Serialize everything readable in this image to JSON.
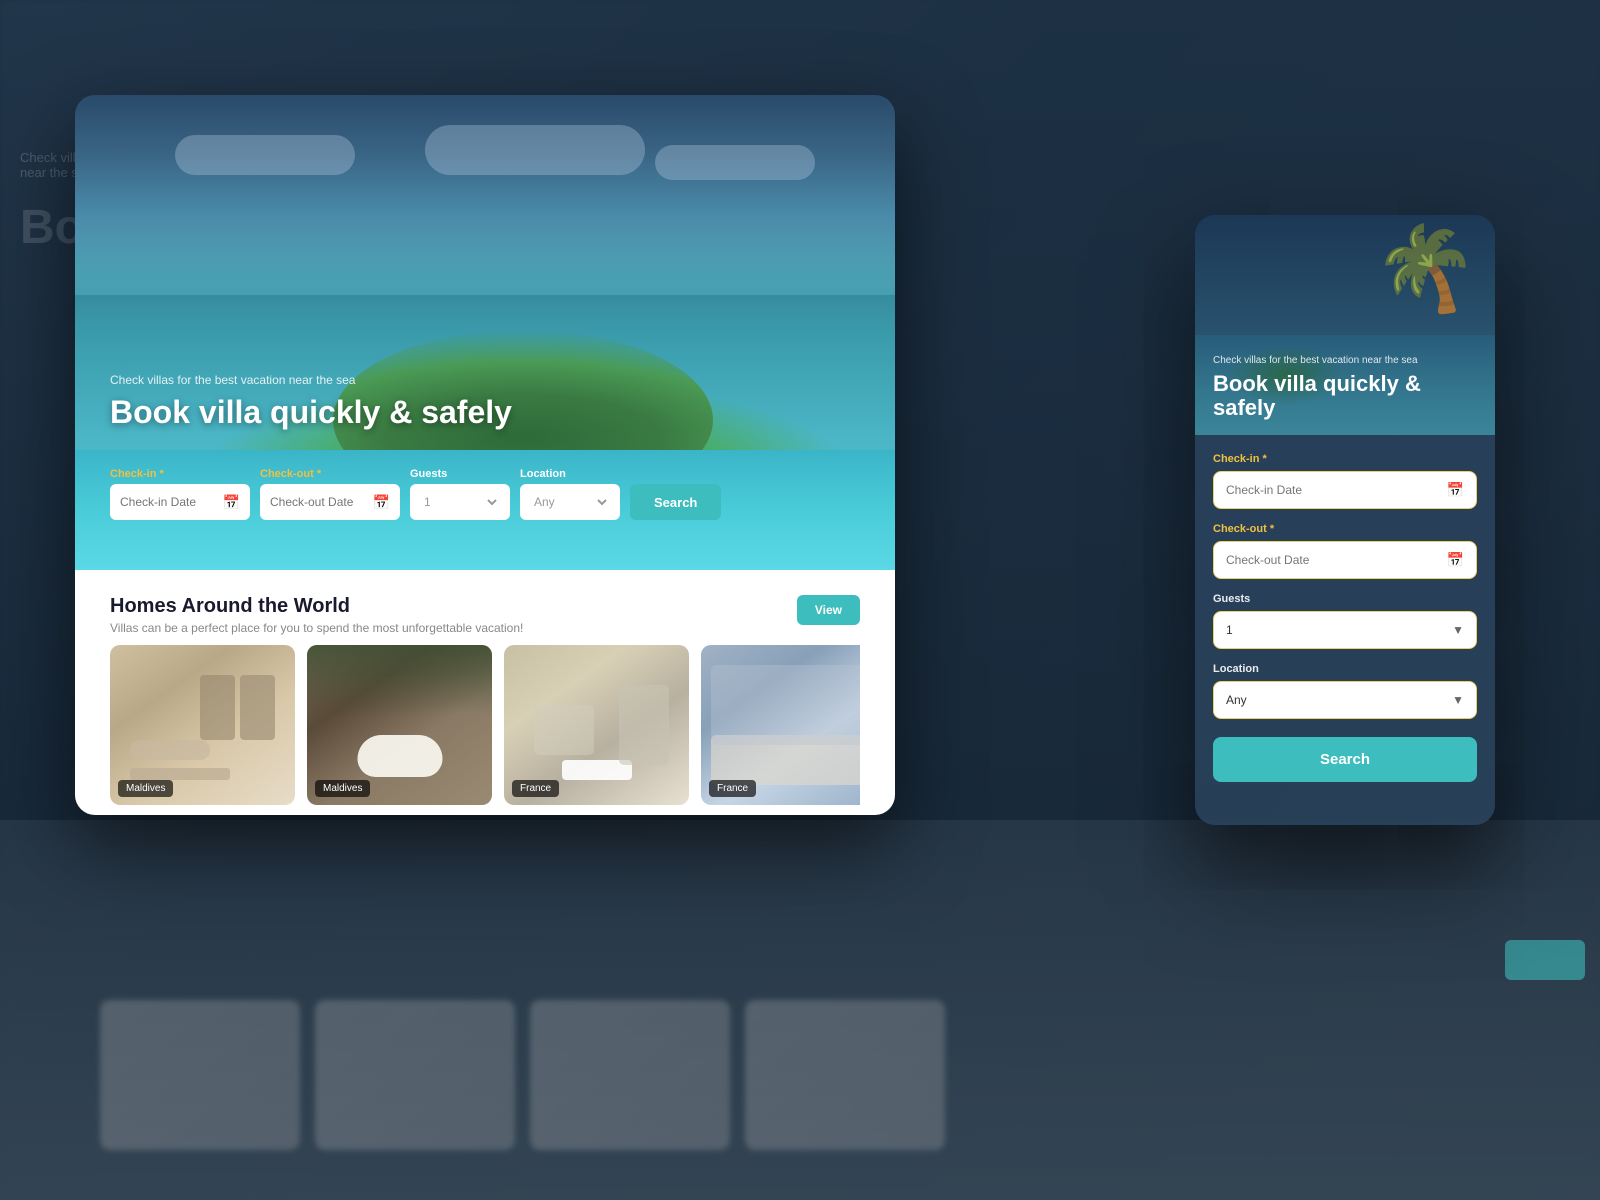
{
  "background": {
    "subtitle": "Check villas for the best vacation near the sea",
    "title": "Bo"
  },
  "desktop": {
    "hero": {
      "subtitle": "Check villas for the best vacation near the sea",
      "title": "Book villa quickly & safely"
    },
    "form": {
      "checkin_label": "Check-in",
      "checkin_placeholder": "Check-in Date",
      "checkout_label": "Check-out",
      "checkout_placeholder": "Check-out Date",
      "guests_label": "Guests",
      "guests_default": "1",
      "location_label": "Location",
      "location_default": "Any",
      "search_label": "Search",
      "required_marker": "*"
    },
    "lower": {
      "title": "Homes Around the World",
      "subtitle": "Villas can be a perfect place for you to spend the most unforgettable vacation!",
      "view_btn": "View",
      "properties": [
        {
          "location": "Maldives",
          "type": "bathroom"
        },
        {
          "location": "Maldives",
          "type": "bathroom-ext"
        },
        {
          "location": "France",
          "type": "living"
        },
        {
          "location": "France",
          "type": "bedroom"
        }
      ]
    }
  },
  "mobile": {
    "hero": {
      "subtitle": "Check villas for the best vacation near the sea",
      "title": "Book villa quickly & safely"
    },
    "form": {
      "checkin_label": "Check-in",
      "checkin_required": "*",
      "checkin_placeholder": "Check-in Date",
      "checkout_label": "Check-out",
      "checkout_required": "*",
      "checkout_placeholder": "Check-out Date",
      "guests_label": "Guests",
      "guests_default": "1",
      "location_label": "Location",
      "location_default": "Any",
      "search_label": "Search"
    }
  }
}
